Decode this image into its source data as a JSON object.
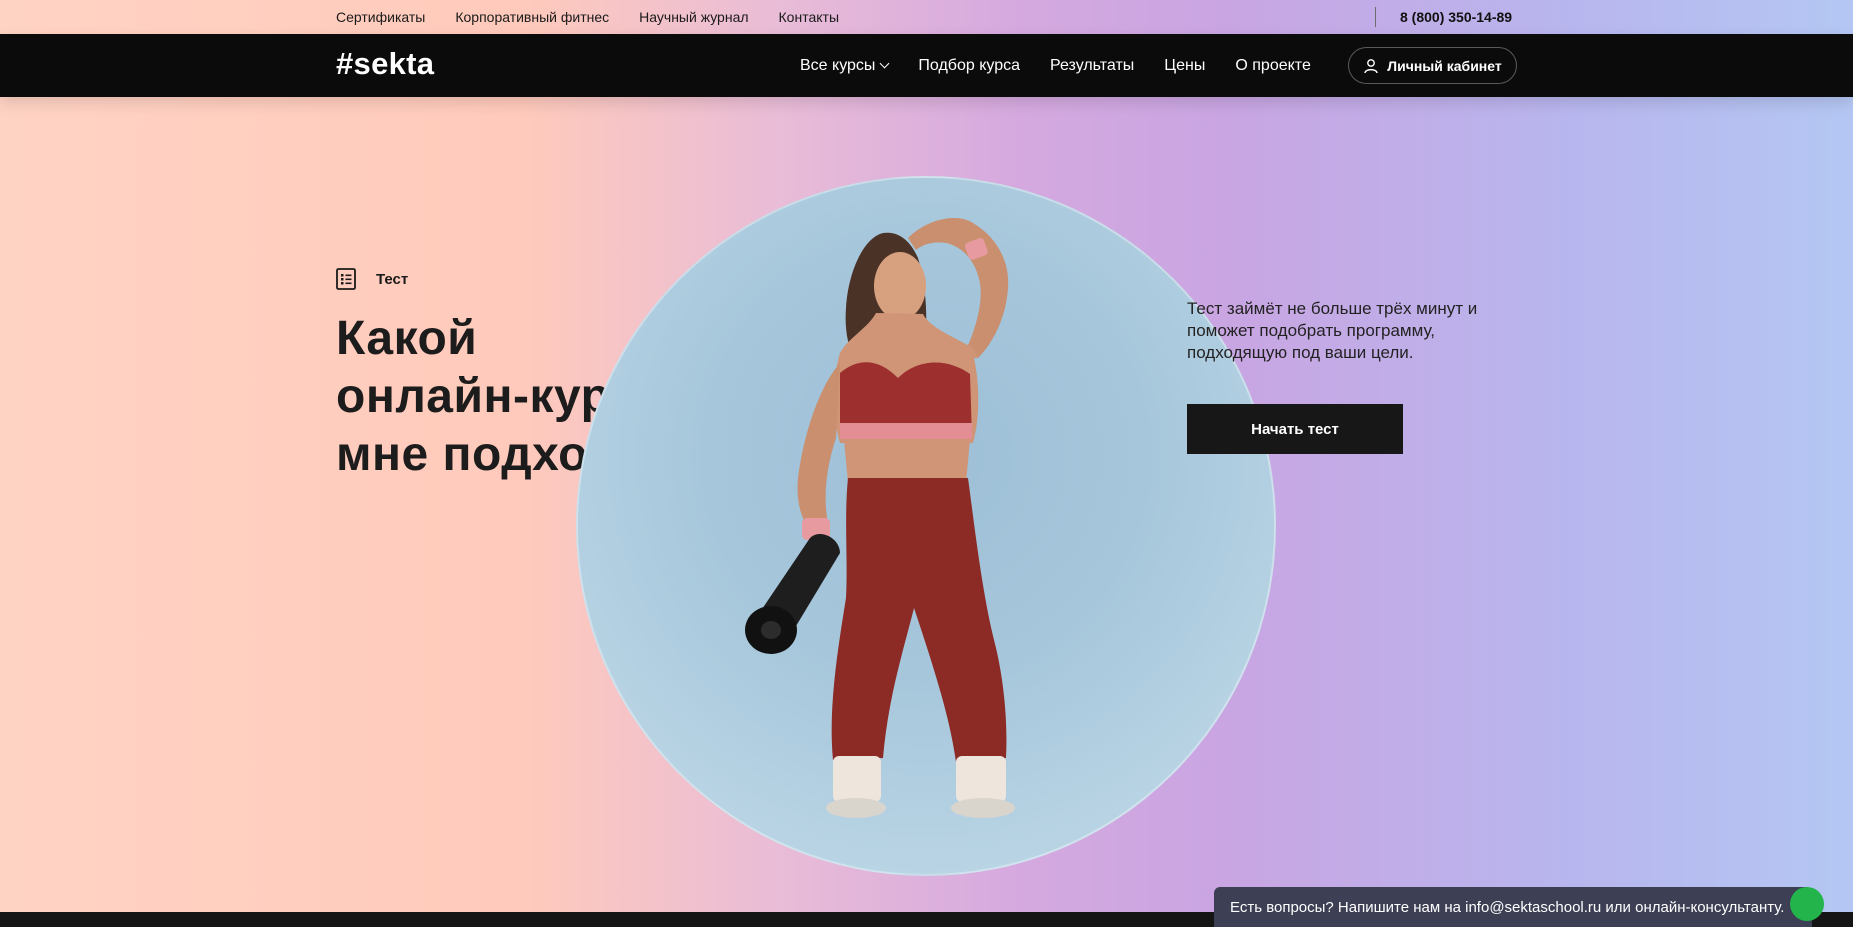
{
  "topbar": {
    "links": [
      "Сертификаты",
      "Корпоративный фитнес",
      "Научный журнал",
      "Контакты"
    ],
    "phone": "8 (800) 350-14-89"
  },
  "navbar": {
    "logo": "#sekta",
    "items": [
      "Все курсы",
      "Подбор курса",
      "Результаты",
      "Цены",
      "О проекте"
    ],
    "cabinet": "Личный кабинет"
  },
  "hero": {
    "badge": "Тест",
    "headline_lines": [
      "Какой",
      "онлайн-курс",
      "мне подходит?"
    ],
    "description": "Тест займёт не больше трёх минут и поможет подобрать программу, подходящую под ваши цели.",
    "button": "Начать тест"
  },
  "chat": {
    "text": "Есть вопросы? Напишите нам на info@sektaschool.ru или онлайн-консультанту."
  },
  "colors": {
    "navbar": "#0b0b0b",
    "button": "#171717",
    "chat": "#3d3f55",
    "chat_dot": "#23b44b"
  }
}
